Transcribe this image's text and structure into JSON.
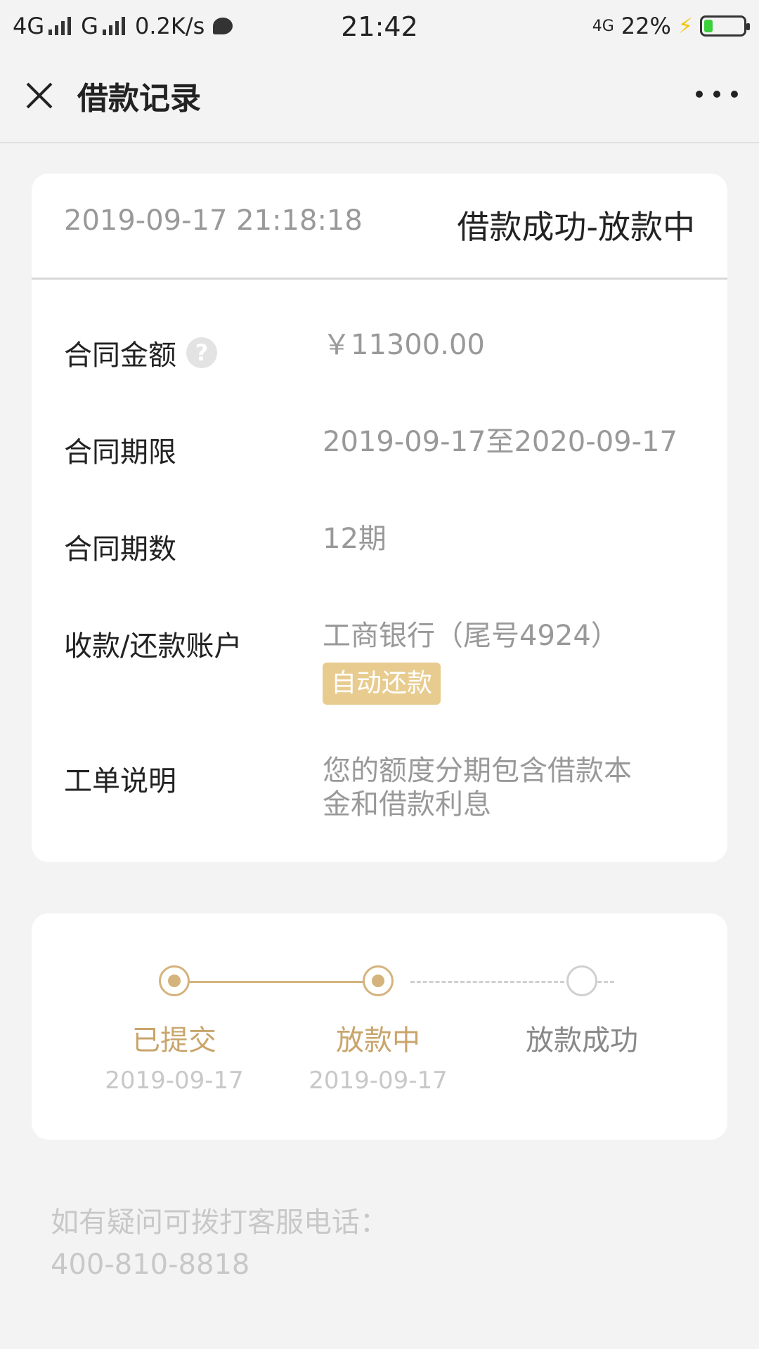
{
  "status_bar": {
    "network_1": "4G",
    "network_2": "G",
    "speed": "0.2K/s",
    "time": "21:42",
    "network_right": "4G",
    "battery_percent": "22%",
    "battery_level": 0.22,
    "battery_color": "#3ccf3c"
  },
  "nav": {
    "title": "借款记录"
  },
  "record": {
    "datetime": "2019-09-17 21:18:18",
    "status": "借款成功-放款中",
    "rows": [
      {
        "label": "合同金额",
        "value": "￥11300.00"
      },
      {
        "label": "合同期限",
        "value": "2019-09-17至2020-09-17"
      },
      {
        "label": "合同期数",
        "value": "12期"
      },
      {
        "label": "收款/还款账户",
        "value": "工商银行（尾号4924）",
        "tag": "自动还款"
      },
      {
        "label": "工单说明",
        "value": "您的额度分期包含借款本金和借款利息"
      }
    ],
    "help_mark": "?"
  },
  "progress": {
    "steps": [
      {
        "label": "已提交",
        "date": "2019-09-17"
      },
      {
        "label": "放款中",
        "date": "2019-09-17"
      },
      {
        "label": "放款成功",
        "date": ""
      }
    ],
    "accent_color": "#c9a56b"
  },
  "footer": {
    "line1": "如有疑问可拨打客服电话：",
    "line2": "400-810-8818"
  }
}
